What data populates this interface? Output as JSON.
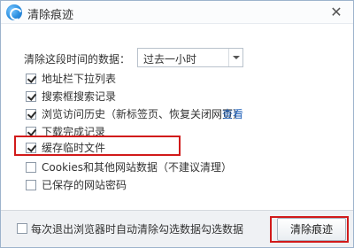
{
  "window": {
    "title": "清除痕迹"
  },
  "time_range": {
    "label": "清除这段时间的数据：",
    "selected": "过去一小时"
  },
  "options": [
    {
      "label": "地址栏下拉列表",
      "checked": true
    },
    {
      "label": "搜索框搜索记录",
      "checked": true
    },
    {
      "label": "浏览访问历史（新标签页、恢复关闭网页）",
      "checked": true,
      "link": "查看"
    },
    {
      "label": "下载完成记录",
      "checked": true
    },
    {
      "label": "缓存临时文件",
      "checked": true
    },
    {
      "label": "Cookies和其他网站数据（不建议清理）",
      "checked": false
    },
    {
      "label": "已保存的网站密码",
      "checked": false
    }
  ],
  "footer": {
    "auto_clear_text": "每次退出浏览器时自动清除勾选数据勾选数据",
    "auto_clear_checked": false
  },
  "actions": {
    "clear_button": "清除痕迹"
  },
  "colors": {
    "highlight": "#d11a1a",
    "link": "#1e5fb8"
  },
  "icons": {
    "app": "browser-logo-icon",
    "close": "close-icon"
  }
}
